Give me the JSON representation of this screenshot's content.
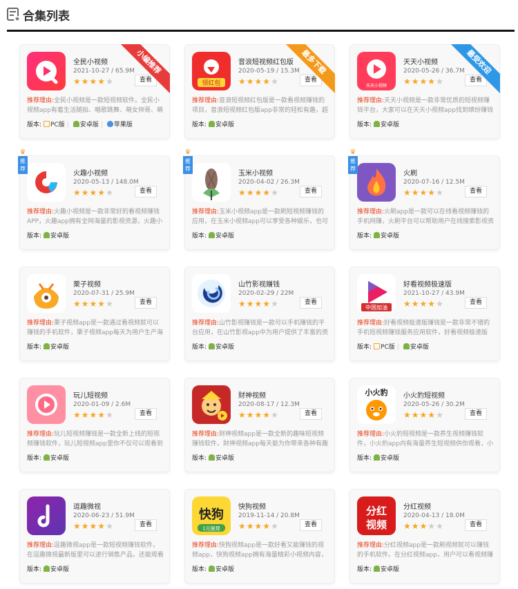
{
  "header": {
    "title": "合集列表"
  },
  "labels": {
    "reason": "推荐理由:",
    "version": "版本:",
    "view": "查看"
  },
  "cards": [
    {
      "name": "全民小视频",
      "meta": "2021-10-27 / 65.9M",
      "rating": 4,
      "reason": "全民小视频是一款短视频软件。全民小视频app有着生活随拍、唱歌跳舞、萌女帅哥、萌宝萌",
      "versions": [
        "PC版",
        "安卓版",
        "苹果版"
      ],
      "ribbon": "小编推荐",
      "ribbon_color": "#e83b3b",
      "logo": "quanmin-logo"
    },
    {
      "name": "音浪短视频红包版",
      "meta": "2020-05-19 / 15.3M",
      "rating": 4,
      "reason": "音浪短视频红包版是一款看视频赚钱的项目，音浪短视频红包版app非常的轻松有趣，超多精选",
      "versions": [
        "安卓版"
      ],
      "ribbon": "最多下载",
      "ribbon_color": "#f39a1a",
      "logo": "yinlang-logo",
      "logo_text": "领红包"
    },
    {
      "name": "天天小视频",
      "meta": "2020-05-26 / 36.7M",
      "rating": 4,
      "reason": "天天小视频是一款非常优质的短视频赚钱平台，大家可以在天天小视频app找到缤纷赚钱任",
      "versions": [
        "安卓版"
      ],
      "ribbon": "最受欢迎",
      "ribbon_color": "#2f98e6",
      "logo": "tiantian-logo",
      "logo_text": "天天小视频"
    },
    {
      "name": "火趣小视频",
      "meta": "2020-05-13 / 148.0M",
      "rating": 4,
      "reason": "火趣小视频是一款非常好的看视频赚钱APP，火趣app拥有全网海量的影视资源，火趣小视频",
      "versions": [
        "安卓版"
      ],
      "badge": "推荐",
      "logo": "huoqu-logo"
    },
    {
      "name": "玉米小视频",
      "meta": "2020-04-02 / 26.3M",
      "rating": 4,
      "reason": "玉米小视频app是一款刷短视频赚钱的应用，在玉米小视频app可以享受各种娱乐，也可以查看",
      "versions": [
        "安卓版"
      ],
      "badge": "推荐",
      "logo": "yumi-logo"
    },
    {
      "name": "火刷",
      "meta": "2020-07-16 / 12.5M",
      "rating": 4,
      "reason": "火刷app是一款可以在线看视频赚钱的手机网赚，火刷平台可以帮助用户在线搜索影视资源、火刷",
      "versions": [
        "安卓版"
      ],
      "badge": "推荐",
      "logo": "huoshua-logo"
    },
    {
      "name": "栗子视频",
      "meta": "2020-07-31 / 25.9M",
      "rating": 4,
      "reason": "栗子视频app是一款通过看视频就可以赚钱的手机软件，栗子视频app每天为用户生产海量丰富优",
      "versions": [
        "安卓版"
      ],
      "logo": "lizi-logo"
    },
    {
      "name": "山竹影视赚钱",
      "meta": "2020-02-29 / 22M",
      "rating": 4,
      "reason": "山竹影视赚钱是一款可以手机赚钱的平台应用，在山竹影视app中为用户提供了丰富的资讯以及短",
      "versions": [
        "安卓版"
      ],
      "logo": "shanzhu-logo"
    },
    {
      "name": "好看视频极速版",
      "meta": "2021-10-27 / 43.9M",
      "rating": 4,
      "reason": "好看视频极速版赚钱是一款非常不错的手机短视频赚钱服务应用软件，好看视频极速版app上用户",
      "versions": [
        "PC版",
        "安卓版"
      ],
      "logo": "haokan-logo",
      "logo_text": "中国加油"
    },
    {
      "name": "玩儿短视频",
      "meta": "2020-01-09 / 2.6M",
      "rating": 4,
      "reason": "玩儿短视频赚钱是一款全新上线的短视频赚钱软件，玩儿短视频app里你不仅可以观看到超多的",
      "versions": [
        "安卓版"
      ],
      "logo": "wan-logo"
    },
    {
      "name": "财神视频",
      "meta": "2020-08-17 / 12.3M",
      "rating": 4,
      "reason": "财神视频app是一款全新的趣味短视频赚钱软件，财神视频app每天能为你带来各种有趣的，热门",
      "versions": [
        "安卓版"
      ],
      "logo": "caishen-logo"
    },
    {
      "name": "小火豹短视频",
      "meta": "2020-05-26 / 30.2M",
      "rating": 4,
      "reason": "小火豹短视频是一款养生视频赚钱软件，小火豹app内有海量养生短视频供你观看，小火豹app让",
      "versions": [
        "安卓版"
      ],
      "logo": "xiaohuobao-logo",
      "logo_text": "小火豹"
    },
    {
      "name": "逗趣微视",
      "meta": "2020-06-23 / 51.9M",
      "rating": 4,
      "reason": "逗趣微视app是一款短视频赚钱软件，在逗趣微视最新版里可以进行销售产品，还能观看自己喜欢",
      "versions": [
        "安卓版"
      ],
      "logo": "douqu-logo"
    },
    {
      "name": "快狗视频",
      "meta": "2019-11-14 / 20.8M",
      "rating": 4,
      "reason": "快狗视频app是一款好看又能赚钱的视频app，快狗视频app拥有海量精彩小视频内容，在快狗",
      "versions": [
        "安卓版"
      ],
      "logo": "kuaigou-logo",
      "logo_text": "快狗",
      "logo_sub": "1元提现"
    },
    {
      "name": "分红视频",
      "meta": "2020-04-13 / 18.0M",
      "rating": 3,
      "reason": "分红视频app是一款刷视频就可以赚钱的手机软件。在分红视频app，用户可以看视频赚钱，做任",
      "versions": [
        "安卓版"
      ],
      "logo": "fenhong-logo",
      "logo_text": "分红视频"
    }
  ]
}
